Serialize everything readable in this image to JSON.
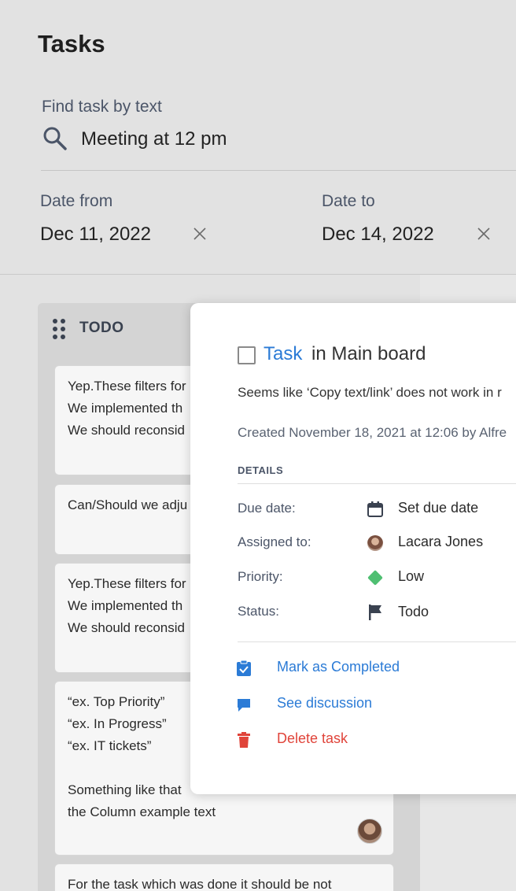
{
  "page": {
    "title": "Tasks"
  },
  "filters": {
    "search_label": "Find task by text",
    "search_value": "Meeting at 12 pm",
    "date_from_label": "Date from",
    "date_from_value": "Dec 11, 2022",
    "date_to_label": "Date to",
    "date_to_value": "Dec 14, 2022"
  },
  "column": {
    "title": "TODO",
    "cards": [
      {
        "lines": [
          "Yep.These filters for",
          "We implemented th",
          "We should reconsid"
        ]
      },
      {
        "lines": [
          "Can/Should we adju"
        ]
      },
      {
        "lines": [
          "Yep.These filters for",
          "We implemented th",
          "We should reconsid"
        ]
      },
      {
        "lines": [
          "“ex. Top Priority”",
          "“ex. In Progress”",
          "“ex. IT tickets”",
          "",
          "Something like that",
          "the Column example text"
        ]
      },
      {
        "lines": [
          "For the task which was done it should be not"
        ]
      }
    ]
  },
  "modal": {
    "type_label": "Task",
    "board_label": "in Main board",
    "description": "Seems like ‘Copy text/link’ does not work in r",
    "created": "Created November 18, 2021 at 12:06 by Alfre",
    "section_title": "DETAILS",
    "details": {
      "due_label": "Due date:",
      "due_value": "Set due date",
      "assigned_label": "Assigned to:",
      "assigned_value": "Lacara Jones",
      "priority_label": "Priority:",
      "priority_value": "Low",
      "status_label": "Status:",
      "status_value": "Todo"
    },
    "actions": {
      "complete": "Mark as Completed",
      "discussion": "See discussion",
      "delete": "Delete task"
    }
  },
  "colors": {
    "accent": "#2b7bd6",
    "danger": "#e0443a",
    "priority_low": "#4fbf72",
    "status_flag": "#3a4250"
  }
}
